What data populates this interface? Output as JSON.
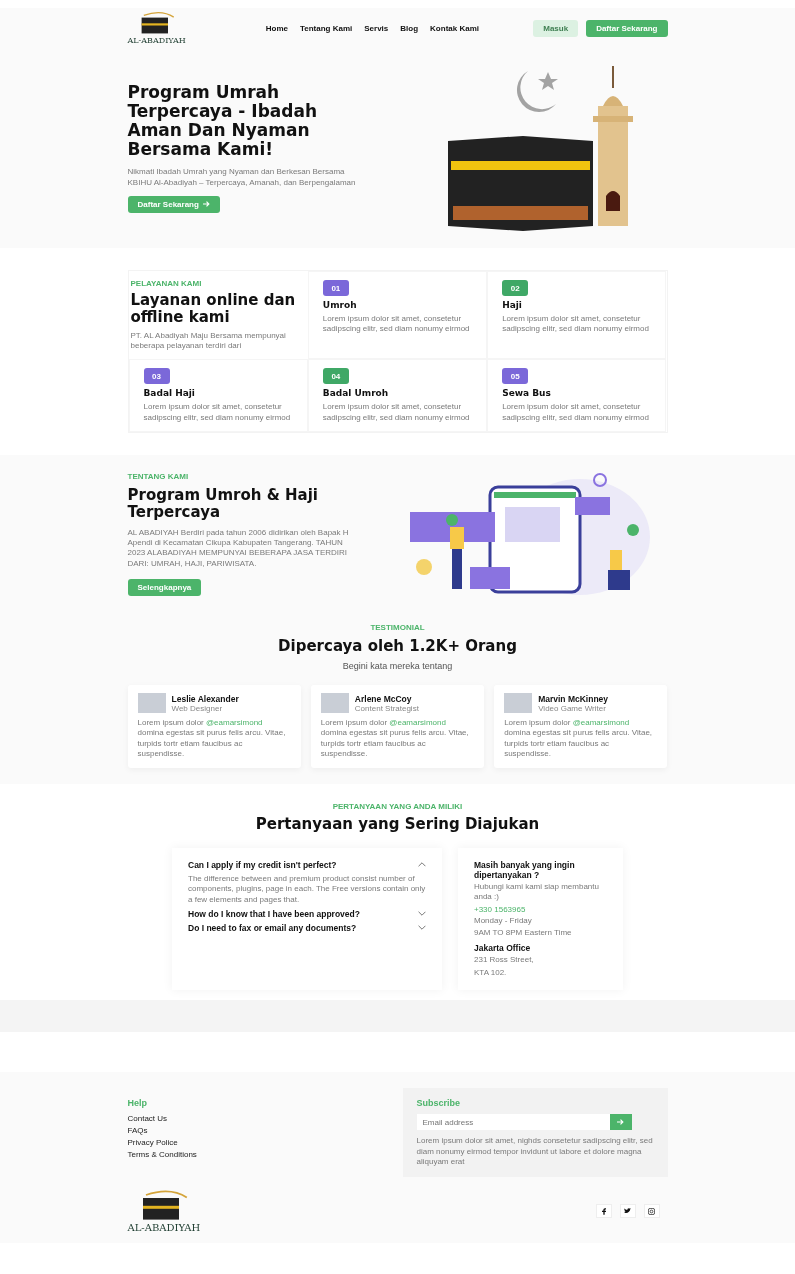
{
  "header": {
    "logo_text": "AL-ABADIYAH",
    "nav": [
      {
        "label": "Home"
      },
      {
        "label": "Tentang Kami"
      },
      {
        "label": "Servis"
      },
      {
        "label": "Blog"
      },
      {
        "label": "Kontak Kami"
      }
    ],
    "login_button": "Masuk",
    "signup_button": "Daftar Sekarang"
  },
  "hero": {
    "title": "Program Umrah Terpercaya - Ibadah Aman Dan Nyaman Bersama Kami!",
    "subtitle": "Nikmati Ibadah Umrah yang Nyaman dan Berkesan Bersama KBIHU Al-Abadiyah – Terpercaya, Amanah, dan Berpengalaman",
    "button": "Daftar Sekarang"
  },
  "services": {
    "eyebrow": "PELAYANAN KAMI",
    "title": "Layanan online dan offline kami",
    "description": "PT. AL Abadiyah Maju Bersama mempunyai beberapa pelayanan terdiri dari",
    "items": [
      {
        "number": "01",
        "title": "Umroh",
        "text": "Lorem ipsum dolor sit amet, consetetur sadipscing elitr, sed diam nonumy eirmod",
        "color": "#7b68d9"
      },
      {
        "number": "02",
        "title": "Haji",
        "text": "Lorem ipsum dolor sit amet, consetetur sadipscing elitr, sed diam nonumy eirmod",
        "color": "#3fa866"
      },
      {
        "number": "03",
        "title": "Badal Haji",
        "text": "Lorem ipsum dolor sit amet, consetetur sadipscing elitr, sed diam nonumy eirmod",
        "color": "#7b68d9"
      },
      {
        "number": "04",
        "title": "Badal Umroh",
        "text": "Lorem ipsum dolor sit amet, consetetur sadipscing elitr, sed diam nonumy eirmod",
        "color": "#3fa866"
      },
      {
        "number": "05",
        "title": "Sewa Bus",
        "text": "Lorem ipsum dolor sit amet, consetetur sadipscing elitr, sed diam nonumy eirmod",
        "color": "#7b68d9"
      }
    ]
  },
  "about": {
    "eyebrow": "TENTANG KAMI",
    "title": "Program Umroh & Haji Terpercaya",
    "text": "AL ABADIYAH Berdiri pada tahun 2006 didirikan oleh Bapak H Apendi di Kecamatan Cikupa Kabupaten Tangerang. TAHUN 2023 ALABADIYAH MEMPUNYAI BEBERAPA JASA TERDIRI DARI: UMRAH, HAJI, PARIWISATA.",
    "button": "Selengkapnya"
  },
  "testimonials": {
    "eyebrow": "TESTIMONIAL",
    "title": "Dipercaya oleh 1.2K+ Orang",
    "subtitle": "Begini kata mereka tentang",
    "items": [
      {
        "name": "Leslie Alexander",
        "role": "Web Designer",
        "text_before": "Lorem ipsum dolor",
        "mention": "@eamarsimond",
        "text_after": "domina egestas sit purus felis arcu. Vitae, turpids tortr etiam faucibus ac suspendisse."
      },
      {
        "name": "Arlene McCoy",
        "role": "Content Strategist",
        "text_before": "Lorem ipsum dolor",
        "mention": "@eamarsimond",
        "text_after": "domina egestas sit purus felis arcu. Vitae, turpids tortr etiam faucibus ac suspendisse."
      },
      {
        "name": "Marvin McKinney",
        "role": "Video Game Writer",
        "text_before": "Lorem ipsum dolor",
        "mention": "@eamarsimond",
        "text_after": "domina egestas sit purus felis arcu. Vitae, turpids tortr etiam faucibus ac suspendisse."
      }
    ]
  },
  "faq": {
    "eyebrow": "PERTANYAAN YANG ANDA MILIKI",
    "title": "Pertanyaan yang Sering Diajukan",
    "items": [
      {
        "question": "Can I apply if my credit isn't perfect?",
        "answer": "The difference between and premium product consist number of components, plugins, page in each. The Free versions contain only a few elements and pages that.",
        "expanded": true
      },
      {
        "question": "How do I know that I have been approved?",
        "expanded": false
      },
      {
        "question": "Do I need to fax or email any documents?",
        "expanded": false
      }
    ],
    "contact": {
      "title": "Masih banyak yang ingin dipertanyakan ?",
      "text": "Hubungi kami kami siap membantu anda :)",
      "phone": "+330 1563965",
      "hours": [
        "Monday - Friday",
        "9AM TO 8PM Eastern Time"
      ],
      "office_title": "Jakarta Office",
      "address": [
        "231 Ross Street,",
        "KTA 102."
      ]
    }
  },
  "footer": {
    "help_title": "Help",
    "links": [
      "Contact Us",
      "FAQs",
      "Privacy Police",
      "Terms & Conditions"
    ],
    "subscribe_title": "Subscribe",
    "email_placeholder": "Email address",
    "subscribe_text": "Lorem ipsum dolor sit amet, nighds consetetur sadipscing elitr, sed diam nonumy eirmod tempor invidunt ut labore et dolore magna aliquyam erat",
    "logo_text": "AL-ABADIYAH"
  }
}
